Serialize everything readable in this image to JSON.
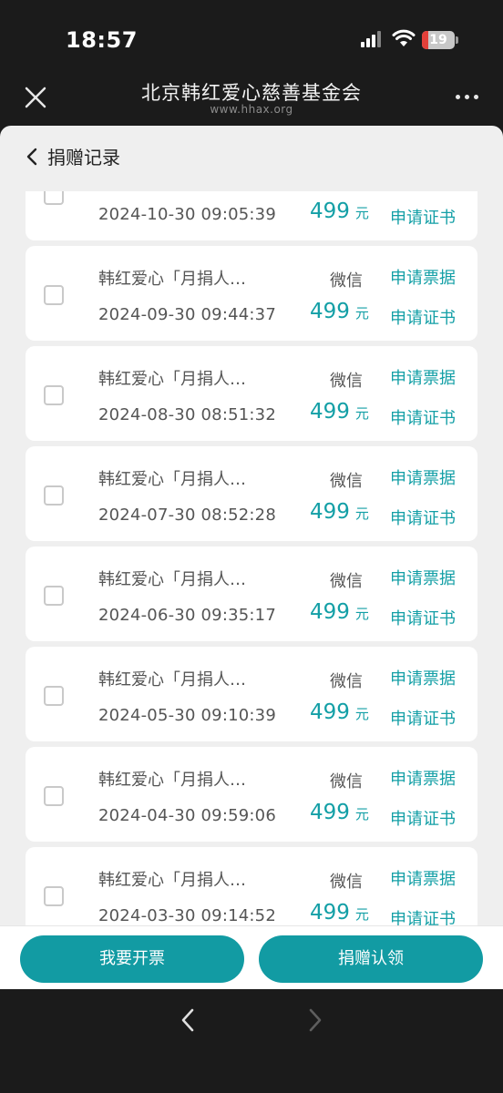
{
  "status_bar": {
    "time": "18:57",
    "battery": "19",
    "battery_level": 0.19
  },
  "title_bar": {
    "title": "北京韩红爱心慈善基金会",
    "subtitle": "www.hhax.org"
  },
  "page": {
    "title": "捐赠记录"
  },
  "records": [
    {
      "name": "",
      "date": "2024-10-30 09:05:39",
      "method": "",
      "amount": "499",
      "unit": "元",
      "receipt_label": "",
      "cert_label": "申请证书"
    },
    {
      "name": "韩红爱心「月捐人…",
      "date": "2024-09-30 09:44:37",
      "method": "微信",
      "amount": "499",
      "unit": "元",
      "receipt_label": "申请票据",
      "cert_label": "申请证书"
    },
    {
      "name": "韩红爱心「月捐人…",
      "date": "2024-08-30 08:51:32",
      "method": "微信",
      "amount": "499",
      "unit": "元",
      "receipt_label": "申请票据",
      "cert_label": "申请证书"
    },
    {
      "name": "韩红爱心「月捐人…",
      "date": "2024-07-30 08:52:28",
      "method": "微信",
      "amount": "499",
      "unit": "元",
      "receipt_label": "申请票据",
      "cert_label": "申请证书"
    },
    {
      "name": "韩红爱心「月捐人…",
      "date": "2024-06-30 09:35:17",
      "method": "微信",
      "amount": "499",
      "unit": "元",
      "receipt_label": "申请票据",
      "cert_label": "申请证书"
    },
    {
      "name": "韩红爱心「月捐人…",
      "date": "2024-05-30 09:10:39",
      "method": "微信",
      "amount": "499",
      "unit": "元",
      "receipt_label": "申请票据",
      "cert_label": "申请证书"
    },
    {
      "name": "韩红爱心「月捐人…",
      "date": "2024-04-30 09:59:06",
      "method": "微信",
      "amount": "499",
      "unit": "元",
      "receipt_label": "申请票据",
      "cert_label": "申请证书"
    },
    {
      "name": "韩红爱心「月捐人…",
      "date": "2024-03-30 09:14:52",
      "method": "微信",
      "amount": "499",
      "unit": "元",
      "receipt_label": "申请票据",
      "cert_label": "申请证书"
    }
  ],
  "actions": {
    "invoice_label": "我要开票",
    "claim_label": "捐赠认领"
  },
  "colors": {
    "accent": "#129ba3",
    "amount": "#139fa6",
    "battery": "#e3403a"
  },
  "icons": [
    "close-icon",
    "more-icon",
    "back-icon",
    "chevron-left-icon",
    "chevron-right-icon",
    "wifi-icon",
    "signal-icon",
    "checkbox-icon"
  ]
}
